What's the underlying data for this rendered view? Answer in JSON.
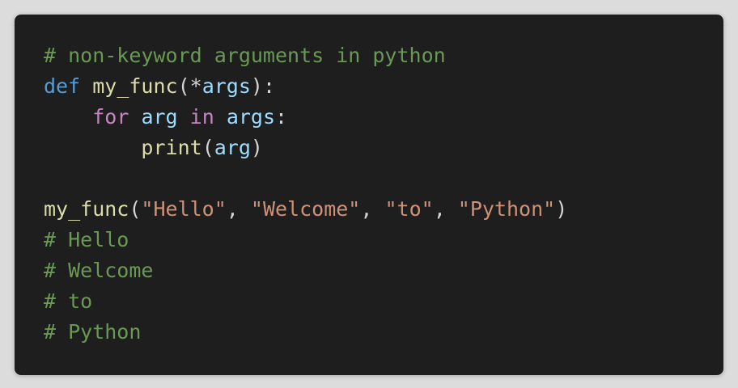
{
  "theme": {
    "page_bg": "#dcdcdc",
    "editor_bg": "#1e1e1e",
    "comment_color": "#6a9955",
    "keyword_color": "#569cd6",
    "control_color": "#c586c0",
    "function_color": "#dcdcaa",
    "variable_color": "#9cdcfe",
    "string_color": "#ce9178",
    "text_color": "#d4d4d4"
  },
  "code": {
    "language": "python",
    "lines": [
      [
        {
          "t": "comment",
          "v": "# non-keyword arguments in python"
        }
      ],
      [
        {
          "t": "kw",
          "v": "def"
        },
        {
          "t": "punct",
          "v": " "
        },
        {
          "t": "fn",
          "v": "my_func"
        },
        {
          "t": "punct",
          "v": "(*"
        },
        {
          "t": "var",
          "v": "args"
        },
        {
          "t": "punct",
          "v": "):"
        }
      ],
      [
        {
          "t": "punct",
          "v": "    "
        },
        {
          "t": "ctrl",
          "v": "for"
        },
        {
          "t": "punct",
          "v": " "
        },
        {
          "t": "var",
          "v": "arg"
        },
        {
          "t": "punct",
          "v": " "
        },
        {
          "t": "ctrl",
          "v": "in"
        },
        {
          "t": "punct",
          "v": " "
        },
        {
          "t": "var",
          "v": "args"
        },
        {
          "t": "punct",
          "v": ":"
        }
      ],
      [
        {
          "t": "punct",
          "v": "        "
        },
        {
          "t": "fn",
          "v": "print"
        },
        {
          "t": "punct",
          "v": "("
        },
        {
          "t": "var",
          "v": "arg"
        },
        {
          "t": "punct",
          "v": ")"
        }
      ],
      [],
      [
        {
          "t": "fn",
          "v": "my_func"
        },
        {
          "t": "punct",
          "v": "("
        },
        {
          "t": "str",
          "v": "\"Hello\""
        },
        {
          "t": "punct",
          "v": ", "
        },
        {
          "t": "str",
          "v": "\"Welcome\""
        },
        {
          "t": "punct",
          "v": ", "
        },
        {
          "t": "str",
          "v": "\"to\""
        },
        {
          "t": "punct",
          "v": ", "
        },
        {
          "t": "str",
          "v": "\"Python\""
        },
        {
          "t": "punct",
          "v": ")"
        }
      ],
      [
        {
          "t": "comment",
          "v": "# Hello"
        }
      ],
      [
        {
          "t": "comment",
          "v": "# Welcome"
        }
      ],
      [
        {
          "t": "comment",
          "v": "# to"
        }
      ],
      [
        {
          "t": "comment",
          "v": "# Python"
        }
      ]
    ]
  }
}
